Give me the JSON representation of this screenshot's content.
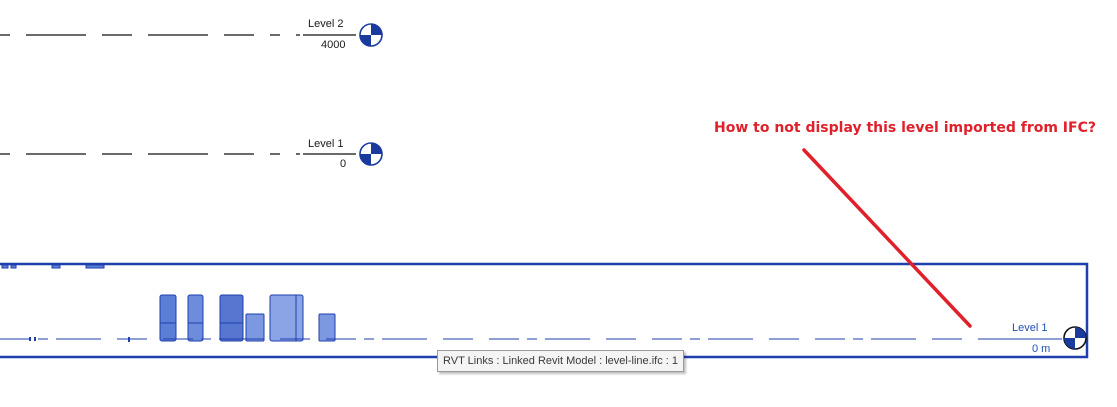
{
  "levels": [
    {
      "name": "Level 2",
      "elevation": "4000"
    },
    {
      "name": "Level 1",
      "elevation": "0"
    }
  ],
  "linked_level": {
    "name": "Level 1",
    "elevation": "0 m"
  },
  "annotation": {
    "text": "How to not display this level imported from IFC?"
  },
  "tooltip": {
    "text": "RVT Links : Linked Revit Model : level-line.ifc : 1"
  },
  "colors": {
    "level_line": "#111111",
    "link_blue": "#1f3fae",
    "annotation_red": "#e0202a",
    "element_fill": "#5b7fd6"
  },
  "icons": {
    "level_head": "level-head-icon",
    "linked_level_head": "linked-level-head-icon"
  }
}
